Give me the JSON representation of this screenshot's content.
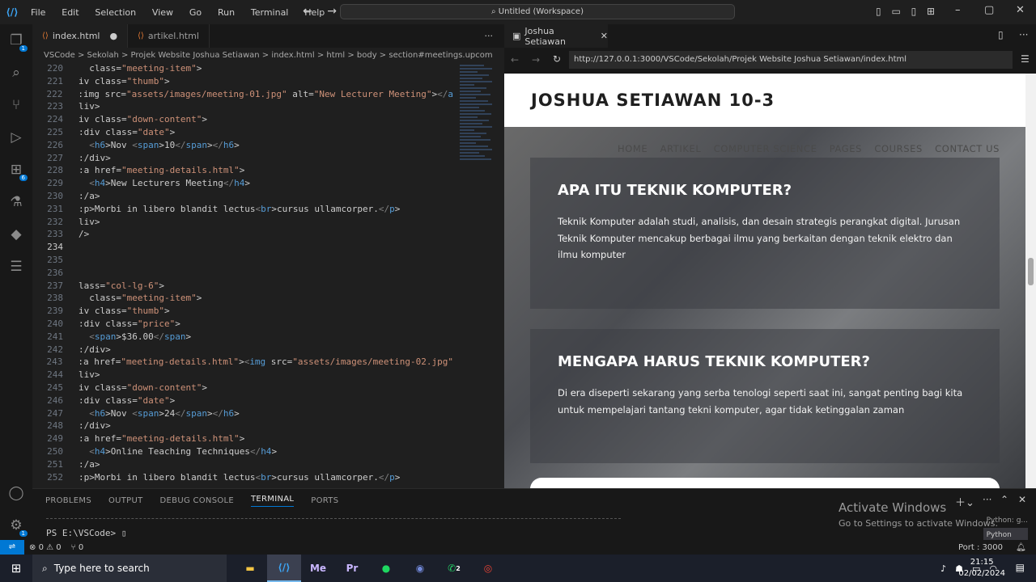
{
  "menu": [
    "File",
    "Edit",
    "Selection",
    "View",
    "Go",
    "Run",
    "Terminal",
    "Help"
  ],
  "command_center": "Untitled (Workspace)",
  "tabs": [
    {
      "label": "index.html"
    },
    {
      "label": "artikel.html"
    }
  ],
  "breadcrumb": "VSCode > Sekolah > Projek Website Joshua Setiawan > index.html > html > body > section#meetings.upcom",
  "code_lines": [
    {
      "num": "220",
      "text": "  class=\"meeting-item\">"
    },
    {
      "num": "221",
      "text": "iv class=\"thumb\">"
    },
    {
      "num": "222",
      "text": ":img src=\"assets/images/meeting-01.jpg\" alt=\"New Lecturer Meeting\"></a"
    },
    {
      "num": "223",
      "text": "liv>"
    },
    {
      "num": "224",
      "text": "iv class=\"down-content\">"
    },
    {
      "num": "225",
      "text": ":div class=\"date\">"
    },
    {
      "num": "226",
      "text": "  <h6>Nov <span>10</span></h6>"
    },
    {
      "num": "227",
      "text": ":/div>"
    },
    {
      "num": "228",
      "text": ":a href=\"meeting-details.html\">"
    },
    {
      "num": "229",
      "text": "  <h4>New Lecturers Meeting</h4>"
    },
    {
      "num": "230",
      "text": ":/a>"
    },
    {
      "num": "231",
      "text": ":p>Morbi in libero blandit lectus<br>cursus ullamcorper.</p>"
    },
    {
      "num": "232",
      "text": "liv>"
    },
    {
      "num": "233",
      "text": "/>"
    },
    {
      "num": "234",
      "text": ""
    },
    {
      "num": "235",
      "text": ""
    },
    {
      "num": "236",
      "text": ""
    },
    {
      "num": "237",
      "text": "lass=\"col-lg-6\">"
    },
    {
      "num": "238",
      "text": "  class=\"meeting-item\">"
    },
    {
      "num": "239",
      "text": "iv class=\"thumb\">"
    },
    {
      "num": "240",
      "text": ":div class=\"price\">"
    },
    {
      "num": "241",
      "text": "  <span>$36.00</span>"
    },
    {
      "num": "242",
      "text": ":/div>"
    },
    {
      "num": "243",
      "text": ":a href=\"meeting-details.html\"><img src=\"assets/images/meeting-02.jpg\""
    },
    {
      "num": "244",
      "text": "liv>"
    },
    {
      "num": "245",
      "text": "iv class=\"down-content\">"
    },
    {
      "num": "246",
      "text": ":div class=\"date\">"
    },
    {
      "num": "247",
      "text": "  <h6>Nov <span>24</span></h6>"
    },
    {
      "num": "248",
      "text": ":/div>"
    },
    {
      "num": "249",
      "text": ":a href=\"meeting-details.html\">"
    },
    {
      "num": "250",
      "text": "  <h4>Online Teaching Techniques</h4>"
    },
    {
      "num": "251",
      "text": ":/a>"
    },
    {
      "num": "252",
      "text": ":p>Morbi in libero blandit lectus<br>cursus ullamcorper.</p>"
    }
  ],
  "browser": {
    "tab_label": "Joshua Setiawan",
    "url": "http://127.0.0.1:3000/VSCode/Sekolah/Projek Website Joshua Setiawan/index.html",
    "site_title": "JOSHUA SETIAWAN 10-3",
    "nav": [
      "HOME",
      "ARTIKEL",
      "COMPUTER SCIENCE",
      "PAGES",
      "COURSES",
      "CONTACT US"
    ],
    "cards": [
      {
        "title": "APA ITU TEKNIK KOMPUTER?",
        "text": "Teknik Komputer adalah studi, analisis, dan desain strategis perangkat digital. Jurusan Teknik Komputer mencakup berbagai ilmu yang berkaitan dengan teknik elektro dan ilmu komputer"
      },
      {
        "title": "MENGAPA HARUS TEKNIK KOMPUTER?",
        "text": "Di era diseperti sekarang yang serba tenologi seperti saat ini, sangat penting bagi kita untuk mempelajari tantang tekni komputer, agar tidak ketinggalan zaman"
      }
    ]
  },
  "panel_tabs": [
    "PROBLEMS",
    "OUTPUT",
    "DEBUG CONSOLE",
    "TERMINAL",
    "PORTS"
  ],
  "terminal_prompt": "PS E:\\VSCode>",
  "activate": {
    "title": "Activate Windows",
    "subtitle": "Go to Settings to activate Windows."
  },
  "terminal_list": [
    "Python: g...",
    "Python"
  ],
  "status": {
    "errors": "0",
    "warnings": "0",
    "ports": "0",
    "port_label": "Port : 3000"
  },
  "taskbar": {
    "search_placeholder": "Type here to search",
    "time": "21:15",
    "date": "02/02/2024",
    "whatsapp_badge": "2"
  },
  "colors": {
    "accent": "#0078d4",
    "tag": "#569cd6",
    "string": "#ce9178",
    "attr": "#9cdcfe"
  }
}
